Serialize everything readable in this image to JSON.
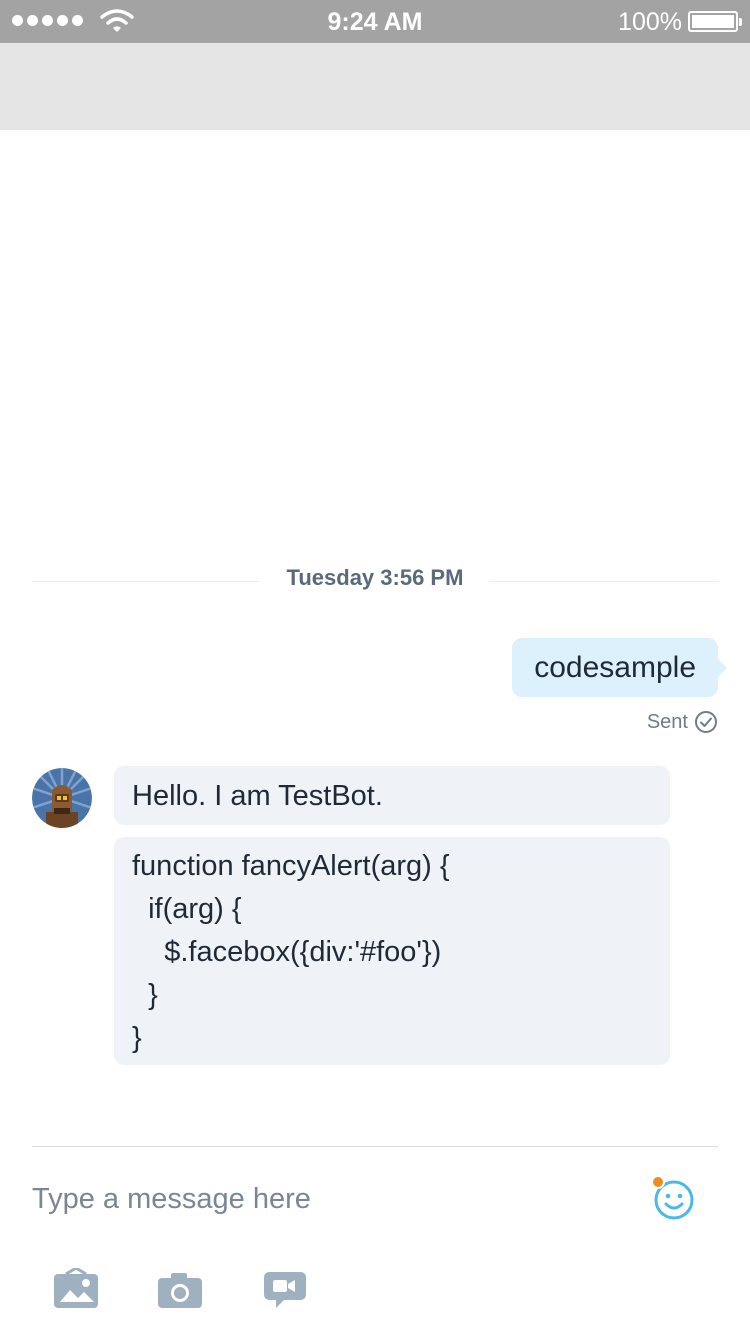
{
  "status_bar": {
    "time": "9:24 AM",
    "battery": "100%",
    "signal_icon": "signal-dots-icon",
    "wifi_icon": "wifi-icon",
    "battery_icon": "battery-full-icon"
  },
  "conversation": {
    "timestamp": "Tuesday 3:56 PM",
    "outgoing": {
      "text": "codesample",
      "status": "Sent",
      "status_icon": "check-circle-icon"
    },
    "bot": {
      "avatar_icon": "robot-avatar-icon",
      "greeting": "Hello. I am TestBot.",
      "code_lines": [
        "function fancyAlert(arg) {",
        "  if(arg) {",
        "    $.facebox({div:'#foo'})",
        "  }",
        "}"
      ]
    }
  },
  "compose": {
    "placeholder": "Type a message here",
    "emoji_icon": "smiley-icon",
    "toolbar": [
      "photo-icon",
      "camera-icon",
      "video-message-icon"
    ]
  },
  "colors": {
    "status_bar_bg": "#a3a3a3",
    "header_bg": "#e5e5e5",
    "outgoing_bubble": "#dcf1fb",
    "incoming_bubble": "#eff3f8",
    "accent": "#4cb7e8",
    "notification_dot": "#f08a24",
    "icon_gray": "#9fb0c1"
  }
}
